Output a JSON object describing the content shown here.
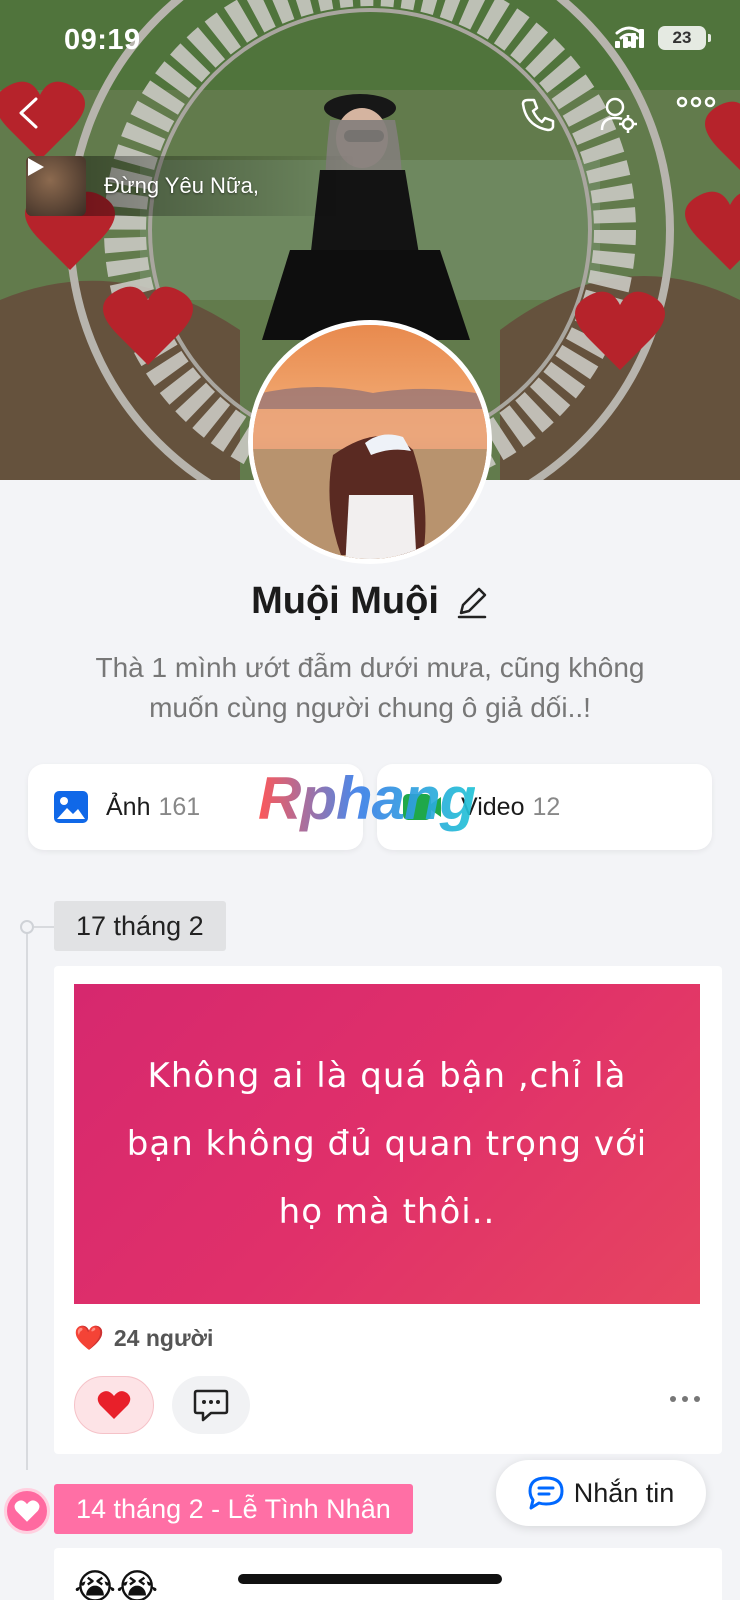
{
  "status_bar": {
    "time": "09:19",
    "battery": "23"
  },
  "music": {
    "title": "Đừng Yêu Nữa,"
  },
  "profile": {
    "name": "Muội Muội",
    "bio": "Thà 1 mình ướt đẫm dưới mưa, cũng không muốn cùng người chung ô giả dối..!"
  },
  "media": {
    "photos_label": "Ảnh",
    "photos_count": "161",
    "videos_label": "Video",
    "videos_count": "12"
  },
  "watermark": "Rphang",
  "timeline": {
    "post1": {
      "date": "17 tháng 2",
      "text": "Không ai là quá bận ,chỉ là bạn không đủ quan trọng với họ mà thôi..",
      "reaction_emoji": "❤️",
      "reactions": "24 người"
    },
    "post2": {
      "date": "14 tháng 2 - Lễ Tình Nhân",
      "emojis": "😭😭"
    }
  },
  "message_button": {
    "label": "Nhắn tin"
  },
  "colors": {
    "accent": "#0068ff",
    "pink": "#ff6fa5",
    "post_bg": "#e0306a"
  }
}
